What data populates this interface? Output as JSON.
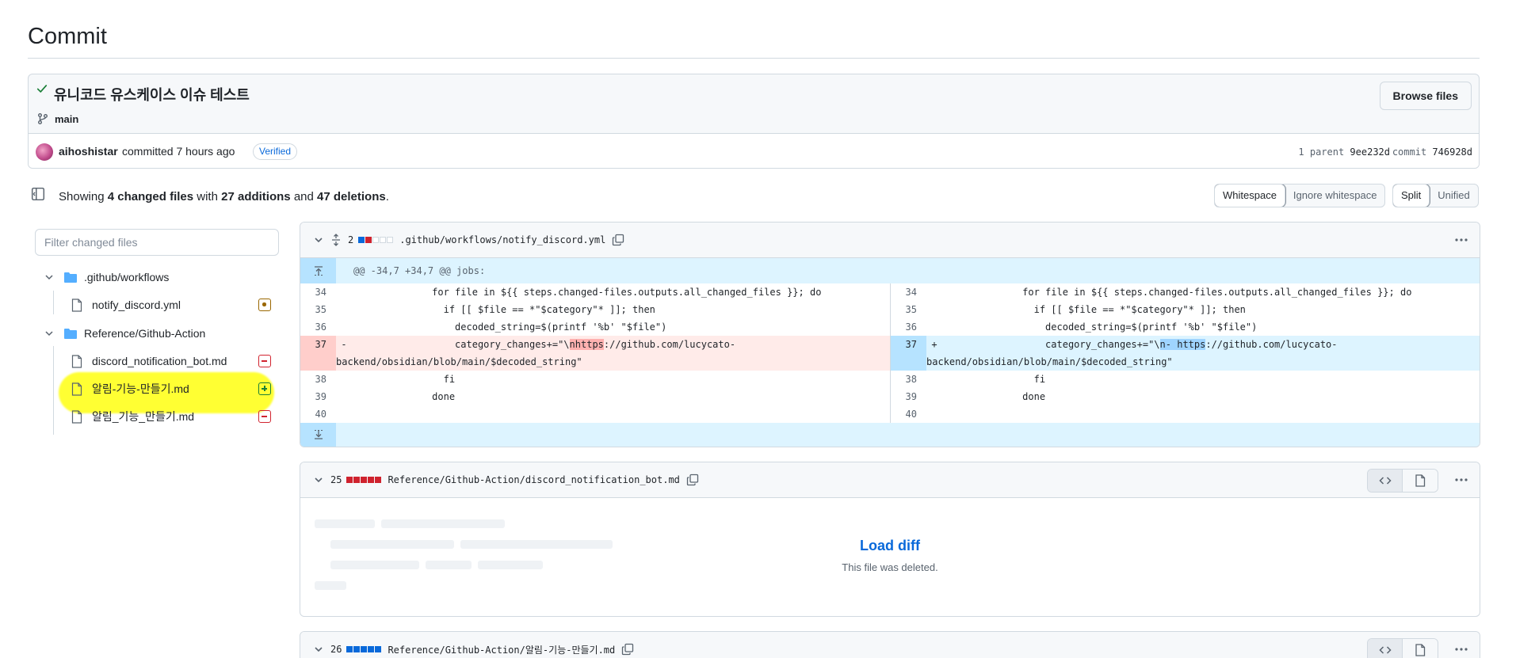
{
  "page": {
    "title": "Commit"
  },
  "commit": {
    "message": "유니코드 유스케이스 이슈 테스트",
    "branch": "main",
    "browse_label": "Browse files",
    "author": "aihoshistar",
    "committed_text": "committed 7 hours ago",
    "verified_label": "Verified",
    "parent_label": "1 parent",
    "parent_hash": "9ee232d",
    "commit_label": "commit",
    "commit_hash": "746928d"
  },
  "summary": {
    "showing": "Showing",
    "changed_files": "4 changed files",
    "with": "with",
    "additions": "27 additions",
    "and": "and",
    "deletions": "47 deletions",
    "period": "."
  },
  "view_options": {
    "whitespace": "Whitespace",
    "ignore_whitespace": "Ignore whitespace",
    "split": "Split",
    "unified": "Unified",
    "whitespace_active": "Whitespace",
    "split_active": "Split"
  },
  "file_tree": {
    "filter_placeholder": "Filter changed files",
    "folders": [
      {
        "name": ".github/workflows",
        "files": [
          {
            "name": "notify_discord.yml",
            "status": "modified"
          }
        ]
      },
      {
        "name": "Reference/Github-Action",
        "files": [
          {
            "name": "discord_notification_bot.md",
            "status": "deleted"
          },
          {
            "name": "알림-기능-만들기.md",
            "status": "added",
            "highlighted": true
          },
          {
            "name": "알림_기능_만들기.md",
            "status": "deleted"
          }
        ]
      }
    ]
  },
  "diffs": [
    {
      "count": "2",
      "path": ".github/workflows/notify_discord.yml",
      "hunk": "@@ -34,7 +34,7 @@ jobs:",
      "left": [
        {
          "n": "34",
          "sign": "",
          "code": "              for file in ${{ steps.changed-files.outputs.all_changed_files }}; do"
        },
        {
          "n": "35",
          "sign": "",
          "code": "                if [[ $file == *\"$category\"* ]]; then"
        },
        {
          "n": "36",
          "sign": "",
          "code": "                  decoded_string=$(printf '%b' \"$file\")"
        },
        {
          "n": "37",
          "sign": "-",
          "code_pre": "                  category_changes+=\"\\",
          "code_hl": "nhttps",
          "code_post": "://github.com/lucycato-",
          "code_wrap": "backend/obsidian/blob/main/$decoded_string\""
        },
        {
          "n": "38",
          "sign": "",
          "code": "                fi"
        },
        {
          "n": "39",
          "sign": "",
          "code": "              done"
        },
        {
          "n": "40",
          "sign": "",
          "code": ""
        }
      ],
      "right": [
        {
          "n": "34",
          "sign": "",
          "code": "              for file in ${{ steps.changed-files.outputs.all_changed_files }}; do"
        },
        {
          "n": "35",
          "sign": "",
          "code": "                if [[ $file == *\"$category\"* ]]; then"
        },
        {
          "n": "36",
          "sign": "",
          "code": "                  decoded_string=$(printf '%b' \"$file\")"
        },
        {
          "n": "37",
          "sign": "+",
          "code_pre": "                  category_changes+=\"\\",
          "code_hl": "n- https",
          "code_post": "://github.com/lucycato-",
          "code_wrap": "backend/obsidian/blob/main/$decoded_string\""
        },
        {
          "n": "38",
          "sign": "",
          "code": "                fi"
        },
        {
          "n": "39",
          "sign": "",
          "code": "              done"
        },
        {
          "n": "40",
          "sign": "",
          "code": ""
        }
      ]
    },
    {
      "count": "25",
      "path": "Reference/Github-Action/discord_notification_bot.md",
      "load_label": "Load diff",
      "load_sub": "This file was deleted."
    },
    {
      "count": "26",
      "path": "Reference/Github-Action/알림-기능-만들기.md"
    }
  ],
  "colors": {
    "accent": "#0969da",
    "added": "#1a7f37",
    "deleted": "#cf222e",
    "modified": "#9a6700",
    "highlight": "#ffff33"
  }
}
